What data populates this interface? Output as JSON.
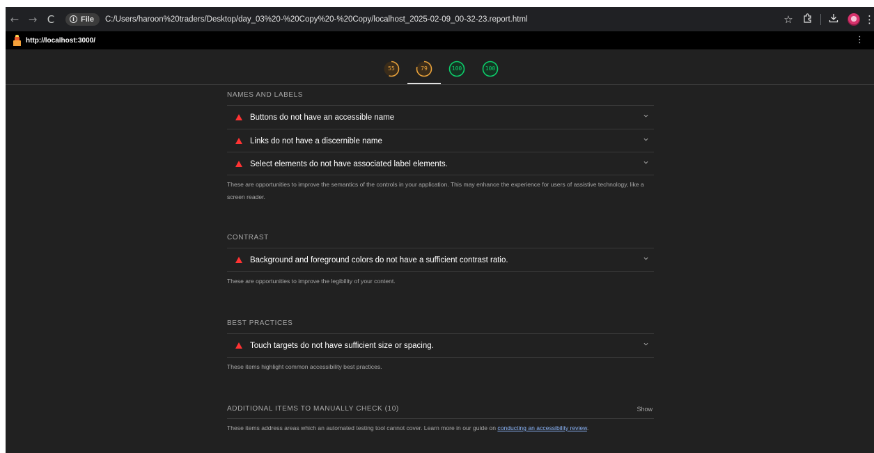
{
  "browser": {
    "back_icon": "arrow-left-icon",
    "forward_icon": "arrow-right-icon",
    "reload_icon": "reload-icon",
    "file_chip_label": "File",
    "url": "C:/Users/haroon%20traders/Desktop/day_03%20-%20Copy%20-%20Copy/localhost_2025-02-09_00-32-23.report.html",
    "icons": [
      "star-icon",
      "extensions-icon",
      "downloads-icon",
      "profile-icon",
      "more-menu-icon"
    ]
  },
  "topbar": {
    "url": "http://localhost:3000/"
  },
  "gauges": [
    {
      "score": "55",
      "value": 55,
      "color": "#e9a23b"
    },
    {
      "score": "79",
      "value": 79,
      "color": "#e9a23b"
    },
    {
      "score": "100",
      "value": 100,
      "color": "#0cce6b"
    },
    {
      "score": "100",
      "value": 100,
      "color": "#0cce6b"
    }
  ],
  "groups": {
    "names": {
      "title": "Names and labels",
      "audits": [
        "Buttons do not have an accessible name",
        "Links do not have a discernible name",
        "Select elements do not have associated label elements."
      ],
      "description": "These are opportunities to improve the semantics of the controls in your application. This may enhance the experience for users of assistive technology, like a screen reader."
    },
    "contrast": {
      "title": "Contrast",
      "audits": [
        "Background and foreground colors do not have a sufficient contrast ratio."
      ],
      "description": "These are opportunities to improve the legibility of your content."
    },
    "best": {
      "title": "Best practices",
      "audits": [
        "Touch targets do not have sufficient size or spacing."
      ],
      "description": "These items highlight common accessibility best practices."
    },
    "manual": {
      "title": "Additional items to manually check (10)",
      "show_label": "Show",
      "description_prefix": "These items address areas which an automated testing tool cannot cover. Learn more in our guide on ",
      "link_text": "conducting an accessibility review",
      "description_suffix": "."
    }
  },
  "colors": {
    "fail_red": "#ff3333",
    "average_orange": "#e9a23b",
    "pass_green": "#0cce6b",
    "report_bg": "#212121",
    "link": "#8ab4f8"
  }
}
